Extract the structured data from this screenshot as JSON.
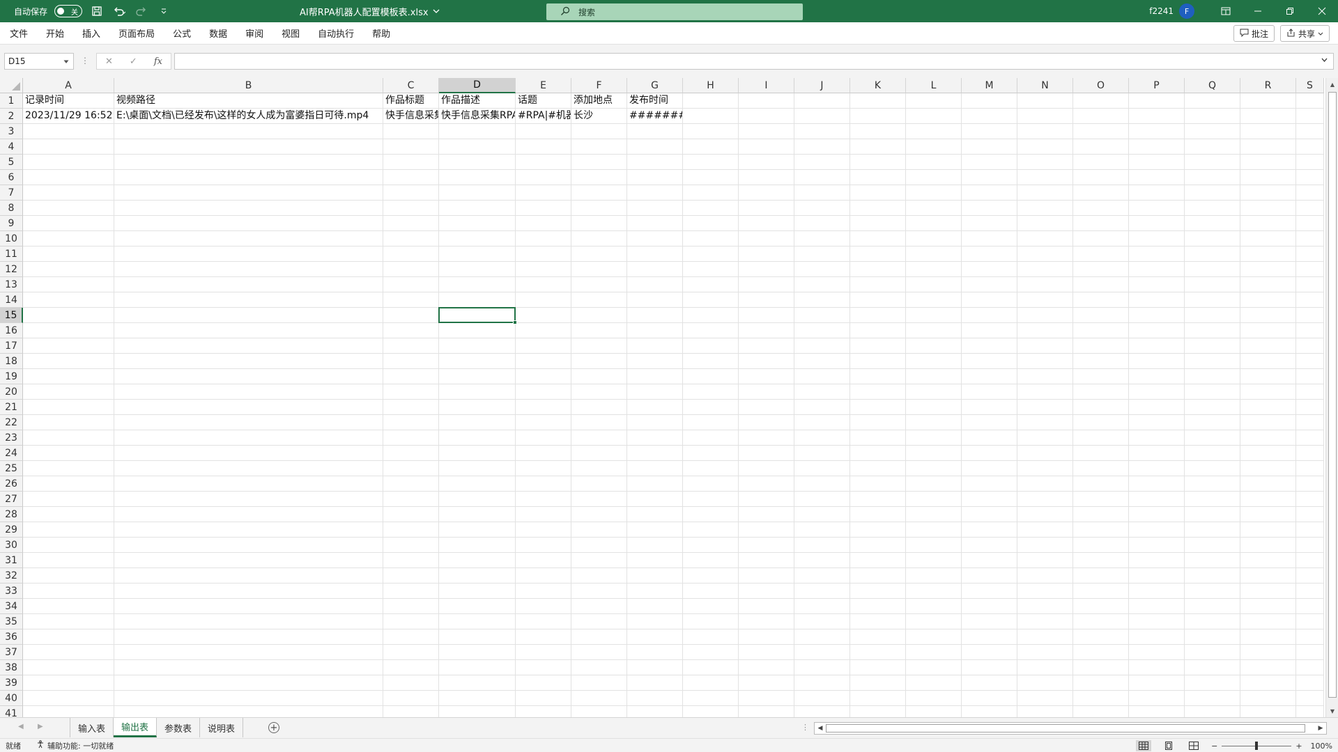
{
  "titlebar": {
    "autosave_label": "自动保存",
    "autosave_state": "关",
    "filename": "AI帮RPA机器人配置模板表.xlsx",
    "search_placeholder": "搜索",
    "user": "f2241",
    "avatar_initial": "F"
  },
  "menu": {
    "items": [
      "文件",
      "开始",
      "插入",
      "页面布局",
      "公式",
      "数据",
      "审阅",
      "视图",
      "自动执行",
      "帮助"
    ],
    "comments_label": "批注",
    "share_label": "共享"
  },
  "formula_bar": {
    "name_box": "D15",
    "formula": ""
  },
  "grid": {
    "columns": [
      {
        "name": "A",
        "width": 131
      },
      {
        "name": "B",
        "width": 386
      },
      {
        "name": "C",
        "width": 80
      },
      {
        "name": "D",
        "width": 110
      },
      {
        "name": "E",
        "width": 80
      },
      {
        "name": "F",
        "width": 80
      },
      {
        "name": "G",
        "width": 80
      },
      {
        "name": "H",
        "width": 80
      },
      {
        "name": "I",
        "width": 80
      },
      {
        "name": "J",
        "width": 80
      },
      {
        "name": "K",
        "width": 80
      },
      {
        "name": "L",
        "width": 80
      },
      {
        "name": "M",
        "width": 80
      },
      {
        "name": "N",
        "width": 80
      },
      {
        "name": "O",
        "width": 80
      },
      {
        "name": "P",
        "width": 80
      },
      {
        "name": "Q",
        "width": 80
      },
      {
        "name": "R",
        "width": 80
      },
      {
        "name": "S",
        "width": 40
      }
    ],
    "row_count": 41,
    "selected_col": "D",
    "selected_row": 15,
    "rows": [
      [
        "记录时间",
        "视频路径",
        "作品标题",
        "作品描述",
        "话题",
        "添加地点",
        "发布时间"
      ],
      [
        "2023/11/29 16:52",
        "E:\\桌面\\文档\\已经发布\\这样的女人成为富婆指日可待.mp4",
        "快手信息采集",
        "快手信息采集RPA",
        "#RPA|#机器人",
        "长沙",
        "#######"
      ]
    ],
    "align": [
      [
        "left",
        "left",
        "left",
        "left",
        "left",
        "left",
        "left"
      ],
      [
        "right",
        "left",
        "left",
        "left",
        "left",
        "left",
        "center"
      ]
    ]
  },
  "sheets": {
    "tabs": [
      "输入表",
      "输出表",
      "参数表",
      "说明表"
    ],
    "active": "输出表"
  },
  "status": {
    "ready": "就绪",
    "accessibility": "辅助功能: 一切就绪",
    "zoom": "100%"
  }
}
